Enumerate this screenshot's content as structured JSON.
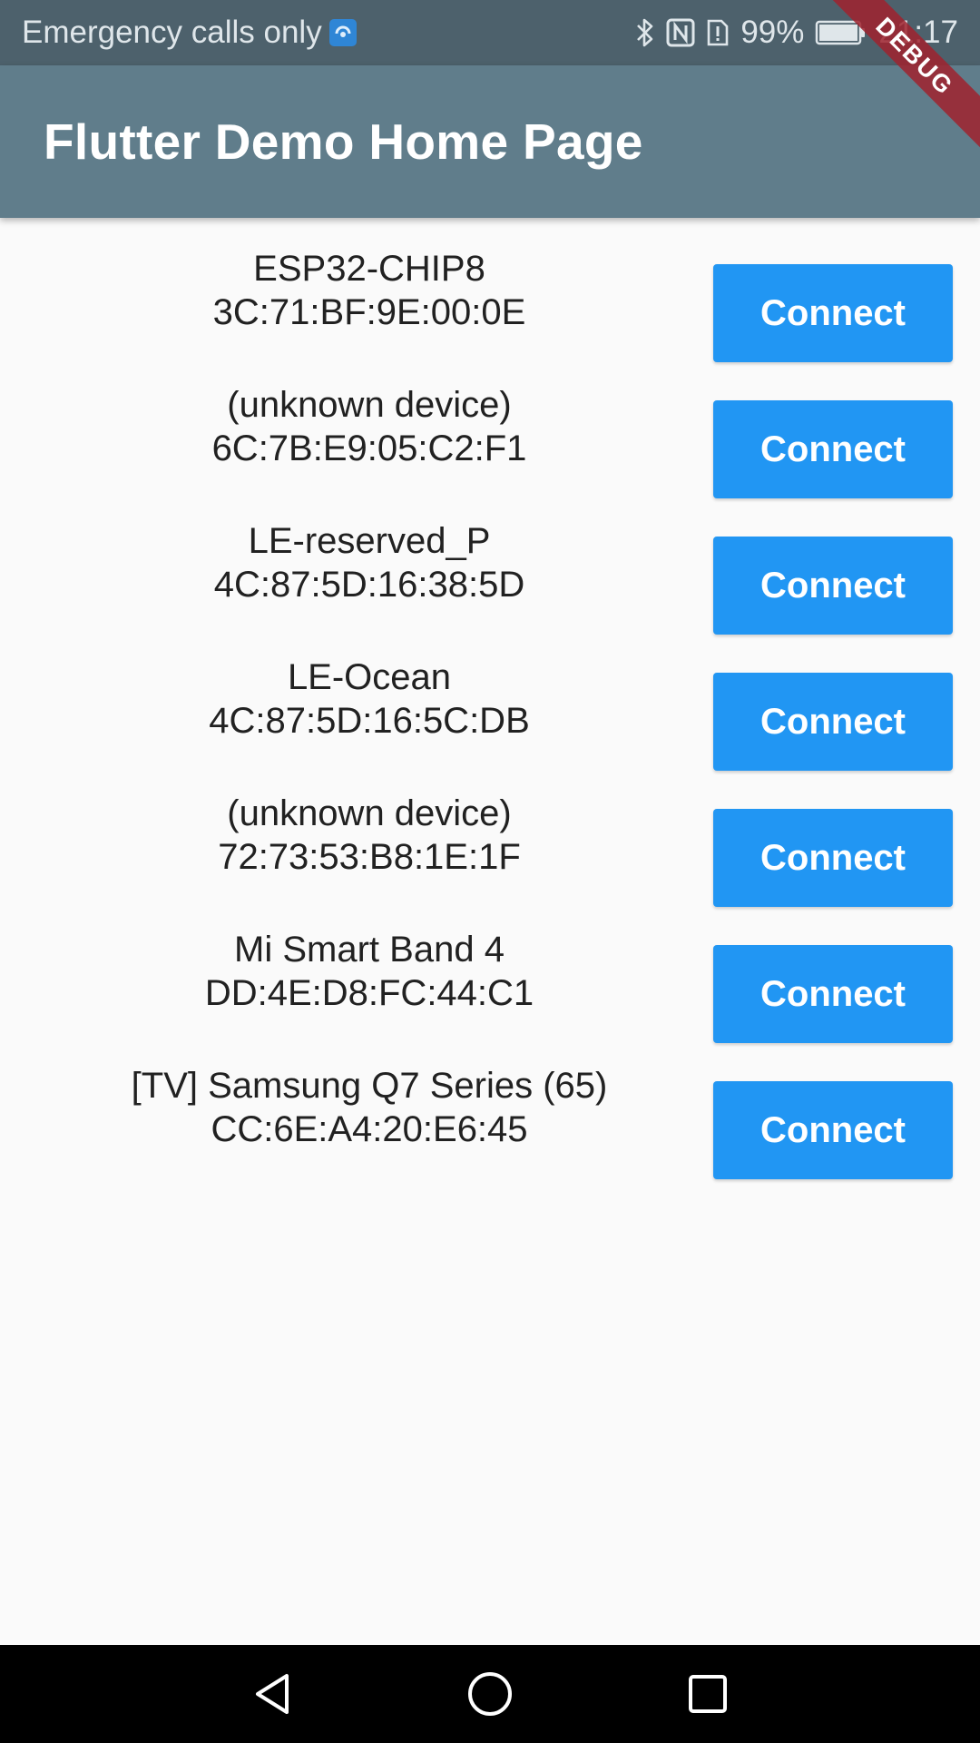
{
  "status_bar": {
    "carrier_text": "Emergency calls only",
    "battery": "99%",
    "time": "21:17",
    "icons": [
      "carrier-badge-icon",
      "bluetooth-icon",
      "nfc-icon",
      "sim-alert-icon",
      "battery-icon"
    ]
  },
  "app_bar": {
    "title": "Flutter Demo Home Page",
    "color": "#607d8b"
  },
  "debug_banner": {
    "label": "DEBUG"
  },
  "devices": [
    {
      "name": "ESP32-CHIP8",
      "address": "3C:71:BF:9E:00:0E",
      "button_label": "Connect"
    },
    {
      "name": "(unknown device)",
      "address": "6C:7B:E9:05:C2:F1",
      "button_label": "Connect"
    },
    {
      "name": "LE-reserved_P",
      "address": "4C:87:5D:16:38:5D",
      "button_label": "Connect"
    },
    {
      "name": "LE-Ocean",
      "address": "4C:87:5D:16:5C:DB",
      "button_label": "Connect"
    },
    {
      "name": "(unknown device)",
      "address": "72:73:53:B8:1E:1F",
      "button_label": "Connect"
    },
    {
      "name": "Mi Smart Band 4",
      "address": "DD:4E:D8:FC:44:C1",
      "button_label": "Connect"
    },
    {
      "name": "[TV] Samsung Q7 Series (65)",
      "address": "CC:6E:A4:20:E6:45",
      "button_label": "Connect"
    }
  ],
  "colors": {
    "button": "#2196f3",
    "status_bar": "#4d616c",
    "background": "#fafafa"
  },
  "nav_bar": {
    "icons": [
      "back-icon",
      "home-icon",
      "recents-icon"
    ]
  }
}
